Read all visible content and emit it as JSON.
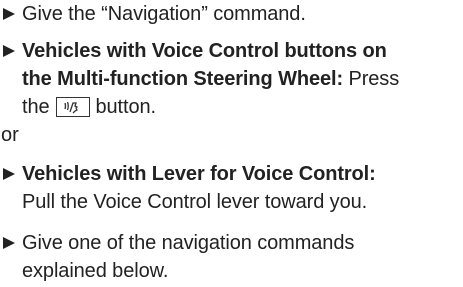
{
  "steps": [
    {
      "line1": "Give the “Navigation” command."
    },
    {
      "line1_bold": "Vehicles with Voice Control buttons on",
      "line2_bold": "the Multi-function Steering Wheel:",
      "line2_rest": " Press",
      "line3_before": "the",
      "line3_after": "button.",
      "button_icon": "voice-control-icon"
    },
    {
      "line1_bold": "Vehicles with Lever for Voice Control:",
      "line2": "Pull the Voice Control lever toward you."
    },
    {
      "line1": "Give one of the navigation commands",
      "line2": "explained below."
    }
  ],
  "or_text": "or"
}
